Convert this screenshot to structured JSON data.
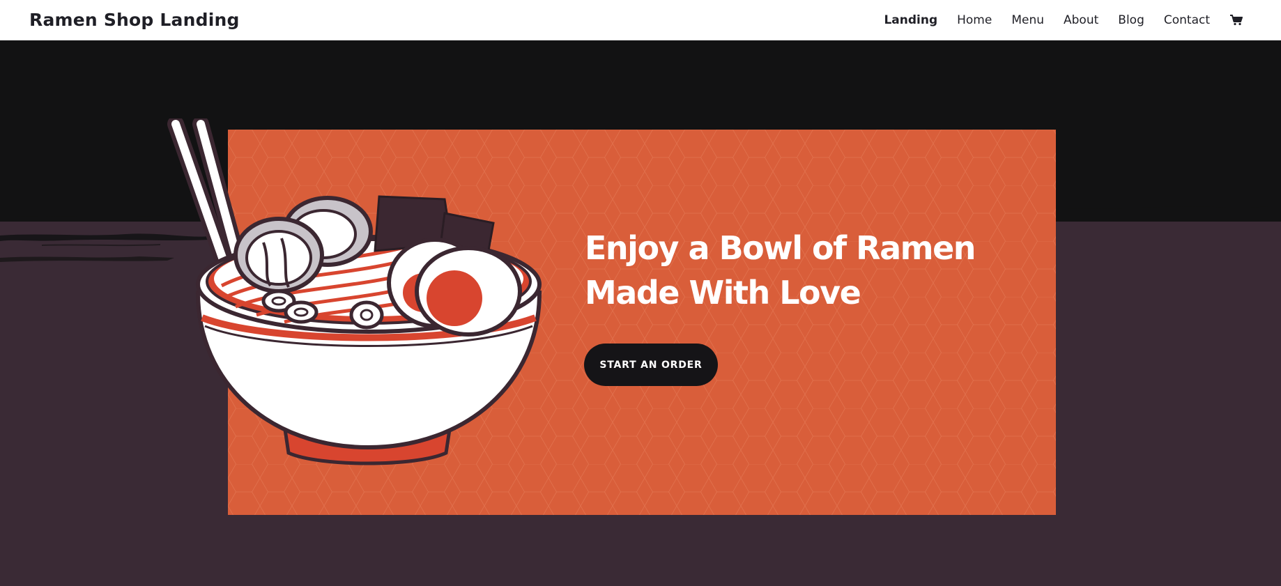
{
  "header": {
    "site_title": "Ramen Shop Landing",
    "nav": [
      {
        "label": "Landing",
        "current": true
      },
      {
        "label": "Home"
      },
      {
        "label": "Menu"
      },
      {
        "label": "About"
      },
      {
        "label": "Blog"
      },
      {
        "label": "Contact"
      }
    ],
    "cart_icon": "shopping-cart-icon"
  },
  "hero": {
    "headline": "Enjoy a Bowl of Ramen Made With Love",
    "cta_label": "START AN ORDER",
    "illustration": "ramen-bowl-illustration"
  },
  "colors": {
    "header_bg": "#ffffff",
    "hero_top": "#121213",
    "hero_bottom": "#3a2a35",
    "panel": "#d95e3a",
    "button": "#151417",
    "text_dark": "#1f1f26"
  }
}
